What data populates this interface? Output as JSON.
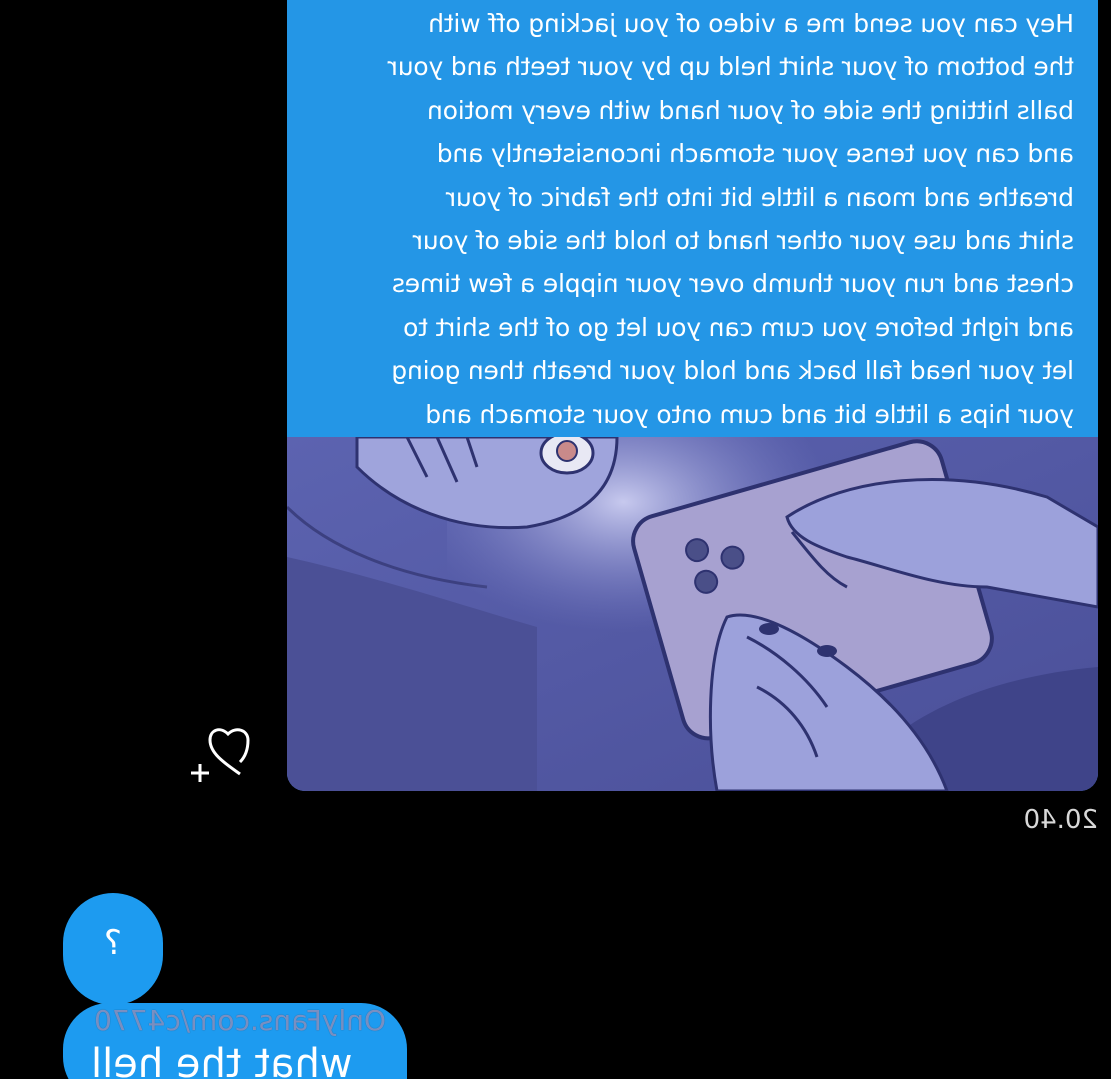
{
  "conversation": {
    "messages": [
      {
        "type": "media",
        "caption": "Hey can you send me a video of you jacking off with\nthe bottom of your shirt held up by your teeth and your\nballs hitting the side of your hand with every motion\nand can you tense your stomach inconsistently and\nbreathe and moan a little bit into the fabric of your\nshirt and use your other hand to hold the side of your\nchest and run your thumb over your nipple a few times\nand right before you cum can you let go of the shirt to\nlet your head fall back and hold your breath then going\nyour hips a little bit and cum onto your stomach and",
        "timestamp": "20.40",
        "image_icon": "illustration-phone-in-bed"
      },
      {
        "type": "text",
        "text": "?"
      },
      {
        "type": "text",
        "text": "what the hell"
      }
    ],
    "watermark": "OnlyFans.com/c4770",
    "react_icon": "heart-plus-icon"
  },
  "colors": {
    "background": "#000000",
    "bubble": "#1d9bf0",
    "timestamp": "#d8d8d8"
  }
}
